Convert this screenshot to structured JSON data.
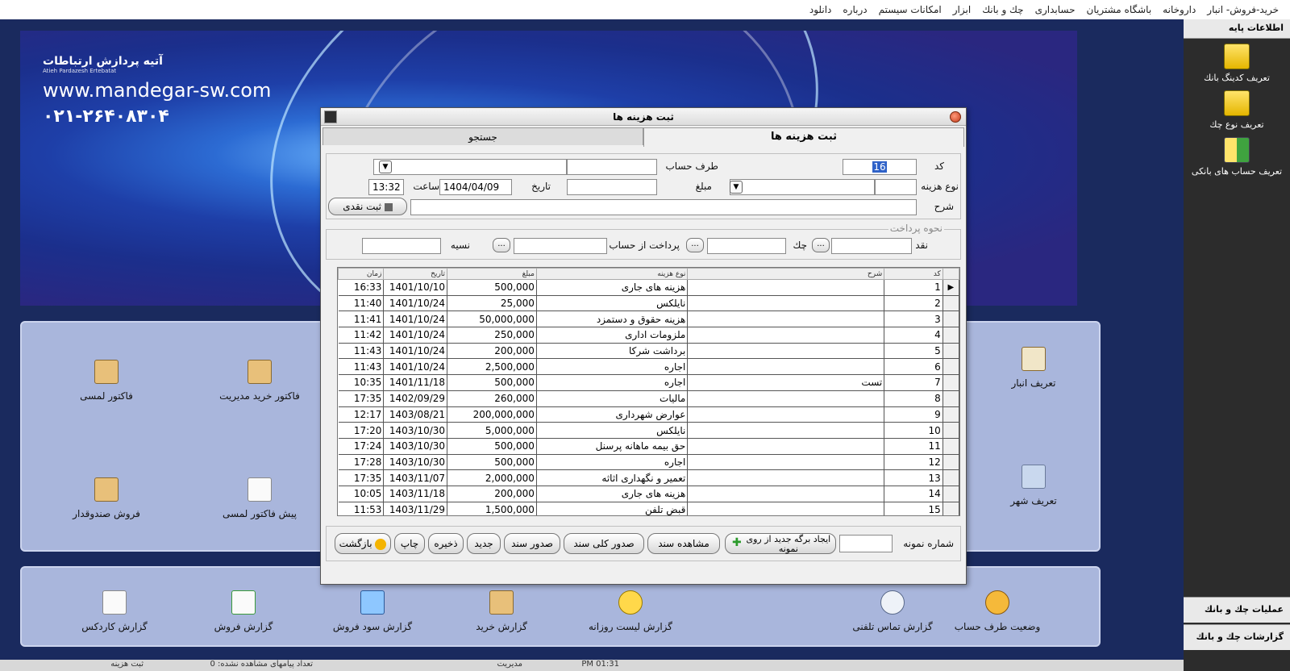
{
  "menu": {
    "items": [
      "خرید-فروش- انبار",
      "داروخانه",
      "باشگاه مشتریان",
      "حسابداری",
      "چك و بانك",
      "ابزار",
      "امكانات سیستم",
      "درباره",
      "دانلود"
    ]
  },
  "right_panel": {
    "header": "اطلاعات پایه",
    "items": [
      {
        "label": "تعریف كدینگ بانك",
        "icon": "bank-coding-icon"
      },
      {
        "label": "تعریف نوع چك",
        "icon": "check-type-icon"
      },
      {
        "label": "تعریف حساب های بانكی",
        "icon": "bank-account-icon"
      }
    ],
    "footer_1": "عملیات چك و بانك",
    "footer_2": "گزارشات چك و بانك"
  },
  "banner": {
    "company_name": "آتیه پردازش ارتباطات",
    "company_sub": "Atieh Pardazesh Ertebatat",
    "website": "www.mandegar-sw.com",
    "phone": "۰۲۱-۲۶۴۰۸۳۰۴"
  },
  "panel_a": {
    "tiles": [
      {
        "label": "فاكتور لمسی",
        "icon": "touch-invoice-icon"
      },
      {
        "label": "فاكتور خرید مدیریت",
        "icon": "purchase-invoice-icon"
      },
      {
        "label": "تعریف انبار",
        "icon": "warehouse-icon"
      },
      {
        "label": "فروش صندوقدار",
        "icon": "cashier-sale-icon"
      },
      {
        "label": "پیش فاكتور لمسی",
        "icon": "pre-invoice-icon"
      },
      {
        "label": "تعریف شهر",
        "icon": "city-icon"
      }
    ]
  },
  "panel_b": {
    "tiles": [
      {
        "label": "گزارش كاردكس",
        "icon": "cardex-report-icon"
      },
      {
        "label": "گزارش فروش",
        "icon": "sales-report-icon"
      },
      {
        "label": "گزارش سود فروش",
        "icon": "profit-report-icon"
      },
      {
        "label": "گزارش خرید",
        "icon": "purchase-report-icon"
      },
      {
        "label": "گزارش لیست روزانه",
        "icon": "daily-list-icon"
      },
      {
        "label": "گزارش تماس تلفنی",
        "icon": "phone-call-icon"
      },
      {
        "label": "وضعیت طرف حساب",
        "icon": "account-status-icon"
      }
    ]
  },
  "status": {
    "title": "ثبت هزینه",
    "messages": "تعداد پیامهای مشاهده نشده: 0",
    "user": "مدیریت",
    "time": "01:31 PM"
  },
  "dialog": {
    "title": "ثبت هزینه ها",
    "tab_active": "ثبت هزینه ها",
    "tab_inactive": "جستجو",
    "labels": {
      "code": "كد",
      "account_party": "طرف حساب",
      "expense_type": "نوع هزینه",
      "amount": "مبلغ",
      "date": "تاریخ",
      "time": "ساعت",
      "description": "شرح",
      "payment_method": "نحوه پرداخت",
      "cash": "نقد",
      "check": "چك",
      "pay_from_account": "پرداخت از حساب",
      "credit": "نسیه",
      "sample_number": "شماره نمونه"
    },
    "values": {
      "code": "16",
      "date": "1404/04/09",
      "time": "13:32"
    },
    "buttons": {
      "cash_register": "ثبت نقدی",
      "create_from_sample": "ایجاد برگه جدید از روی نمونه",
      "view_doc": "مشاهده سند",
      "issue_total_doc": "صدور كلی سند",
      "issue_doc": "صدور سند",
      "new": "جدید",
      "save": "ذخیره",
      "print": "چاپ",
      "back": "بازگشت"
    },
    "grid": {
      "headers": [
        "كد",
        "شرح",
        "نوع هزینه",
        "مبلغ",
        "تاریخ",
        "زمان"
      ],
      "rows": [
        {
          "code": "1",
          "desc": "",
          "type": "هزینه های جاری",
          "amount": "500,000",
          "date": "1401/10/10",
          "time": "16:33"
        },
        {
          "code": "2",
          "desc": "",
          "type": "نایلكس",
          "amount": "25,000",
          "date": "1401/10/24",
          "time": "11:40"
        },
        {
          "code": "3",
          "desc": "",
          "type": "هزینه حقوق و دستمزد",
          "amount": "50,000,000",
          "date": "1401/10/24",
          "time": "11:41"
        },
        {
          "code": "4",
          "desc": "",
          "type": "ملزومات اداری",
          "amount": "250,000",
          "date": "1401/10/24",
          "time": "11:42"
        },
        {
          "code": "5",
          "desc": "",
          "type": "برداشت  شركا",
          "amount": "200,000",
          "date": "1401/10/24",
          "time": "11:43"
        },
        {
          "code": "6",
          "desc": "",
          "type": "اجاره",
          "amount": "2,500,000",
          "date": "1401/10/24",
          "time": "11:43"
        },
        {
          "code": "7",
          "desc": "تست",
          "type": "اجاره",
          "amount": "500,000",
          "date": "1401/11/18",
          "time": "10:35"
        },
        {
          "code": "8",
          "desc": "",
          "type": "مالیات",
          "amount": "260,000",
          "date": "1402/09/29",
          "time": "17:35"
        },
        {
          "code": "9",
          "desc": "",
          "type": "عوارض شهرداری",
          "amount": "200,000,000",
          "date": "1403/08/21",
          "time": "12:17"
        },
        {
          "code": "10",
          "desc": "",
          "type": "نایلكس",
          "amount": "5,000,000",
          "date": "1403/10/30",
          "time": "17:20"
        },
        {
          "code": "11",
          "desc": "",
          "type": "حق بیمه ماهانه پرسنل",
          "amount": "500,000",
          "date": "1403/10/30",
          "time": "17:24"
        },
        {
          "code": "12",
          "desc": "",
          "type": "اجاره",
          "amount": "500,000",
          "date": "1403/10/30",
          "time": "17:28"
        },
        {
          "code": "13",
          "desc": "",
          "type": "تعمیر و نگهداری اثاثه",
          "amount": "2,000,000",
          "date": "1403/11/07",
          "time": "17:35"
        },
        {
          "code": "14",
          "desc": "",
          "type": "هزینه های جاری",
          "amount": "200,000",
          "date": "1403/11/18",
          "time": "10:05"
        },
        {
          "code": "15",
          "desc": "",
          "type": "قبض تلفن",
          "amount": "1,500,000",
          "date": "1403/11/29",
          "time": "11:53"
        }
      ]
    }
  }
}
